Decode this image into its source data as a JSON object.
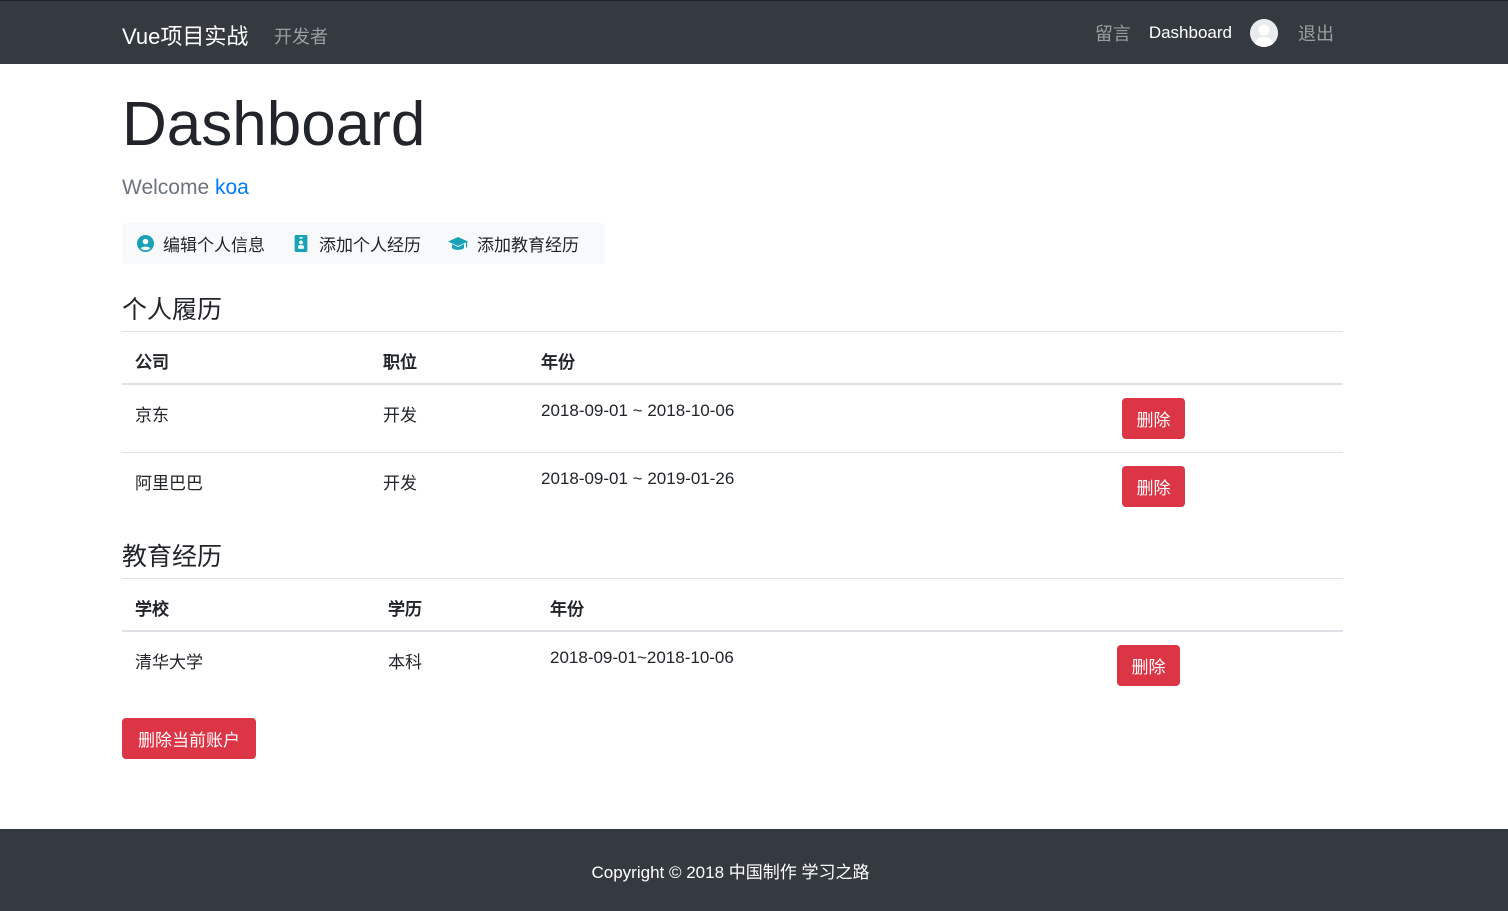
{
  "navbar": {
    "brand": "Vue项目实战",
    "developers_link": "开发者",
    "messages_link": "留言",
    "dashboard_link": "Dashboard",
    "logout_link": "退出"
  },
  "main": {
    "title": "Dashboard",
    "welcome_prefix": "Welcome",
    "username": "koa",
    "actions": [
      {
        "label": "编辑个人信息",
        "icon": "user-circle-icon"
      },
      {
        "label": "添加个人经历",
        "icon": "id-badge-icon"
      },
      {
        "label": "添加教育经历",
        "icon": "graduation-cap-icon"
      }
    ],
    "experience": {
      "title": "个人履历",
      "headers": [
        "公司",
        "职位",
        "年份"
      ],
      "rows": [
        {
          "company": "京东",
          "position": "开发",
          "years": "2018-09-01 ~ 2018-10-06",
          "delete_label": "删除"
        },
        {
          "company": "阿里巴巴",
          "position": "开发",
          "years": "2018-09-01 ~ 2019-01-26",
          "delete_label": "删除"
        }
      ]
    },
    "education": {
      "title": "教育经历",
      "headers": [
        "学校",
        "学历",
        "年份"
      ],
      "rows": [
        {
          "school": "清华大学",
          "degree": "本科",
          "years": "2018-09-01~2018-10-06",
          "delete_label": "删除"
        }
      ]
    },
    "delete_account_label": "删除当前账户"
  },
  "footer": {
    "text": "Copyright © 2018 中国制作 学习之路"
  },
  "colors": {
    "navbar_bg": "#343a40",
    "danger": "#dc3545",
    "link": "#007bff",
    "icon_teal": "#17a2b8"
  }
}
